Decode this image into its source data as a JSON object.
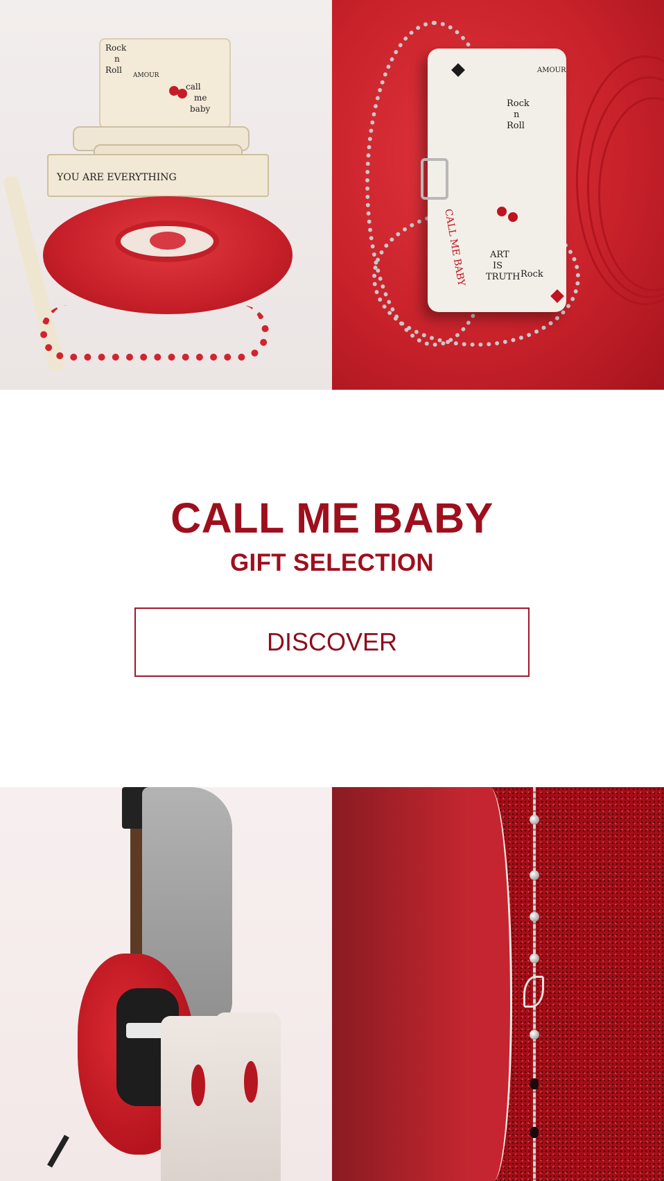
{
  "banner": {
    "headline": "CALL ME BABY",
    "subheadline": "GIFT SELECTION",
    "cta_label": "DISCOVER"
  },
  "images": {
    "top_left": {
      "scribbles": [
        "Rock",
        "n",
        "Roll",
        "AMOUR",
        "call",
        "me",
        "baby",
        "YOU ARE EVERYTHING"
      ]
    },
    "top_right": {
      "scribbles": [
        "AMOUR",
        "Rock",
        "n",
        "Roll",
        "CALL ME BABY",
        "ART",
        "IS",
        "TRUTH",
        "Rock"
      ]
    }
  },
  "colors": {
    "brand_red": "#9e0f1d",
    "button_border": "#a3172a",
    "background": "#ffffff"
  }
}
